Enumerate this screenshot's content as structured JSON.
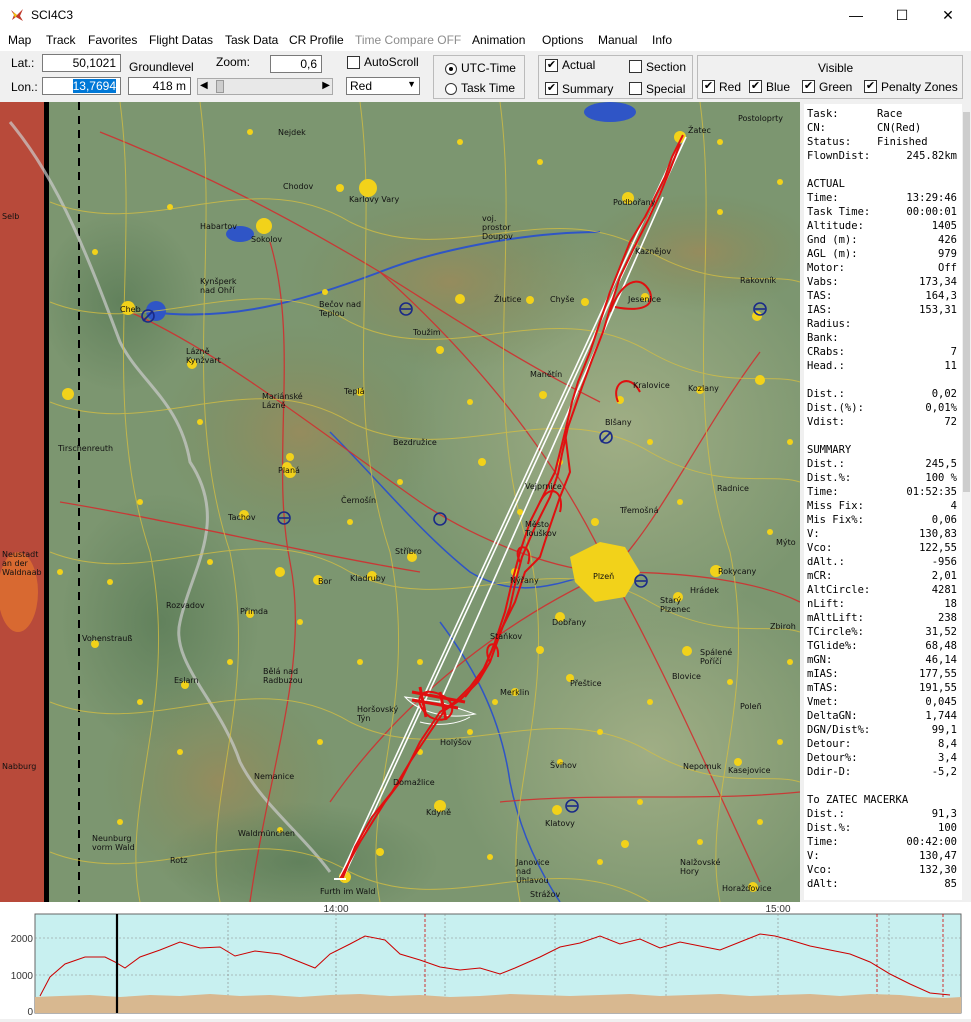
{
  "window": {
    "title": "SCI4C3",
    "minimize": "—",
    "maximize": "☐",
    "close": "✕"
  },
  "menu": [
    "Map",
    "Track",
    "Favorites",
    "Flight Datas",
    "Task Data",
    "CR Profile",
    "Time Compare OFF",
    "Animation",
    "Options",
    "Manual",
    "Info"
  ],
  "toolbar": {
    "lat_label": "Lat.:",
    "lat_value": "50,1021",
    "lon_label": "Lon.:",
    "lon_value": "13,7694",
    "groundlevel_label": "Groundlevel",
    "groundlevel_value": "418 m",
    "zoom_label": "Zoom:",
    "zoom_value": "0,6",
    "autoscroll_label": "AutoScroll",
    "autoscroll_checked": false,
    "pilot_select": "Red",
    "utc_label": "UTC-Time",
    "task_time_label": "Task Time",
    "time_mode": "UTC-Time",
    "actual_label": "Actual",
    "summary_label": "Summary",
    "section_label": "Section",
    "special_label": "Special",
    "visible_title": "Visible",
    "visible_items": [
      {
        "label": "Red",
        "checked": true
      },
      {
        "label": "Blue",
        "checked": true
      },
      {
        "label": "Green",
        "checked": true
      },
      {
        "label": "Penalty Zones",
        "checked": true
      }
    ]
  },
  "map": {
    "towns": [
      {
        "name": "Nejdek"
      },
      {
        "name": "Chodov"
      },
      {
        "name": "Karlovy Vary"
      },
      {
        "name": "Habartov"
      },
      {
        "name": "Sokolov"
      },
      {
        "name": "voj. prostor Doupov"
      },
      {
        "name": "Podbořany"
      },
      {
        "name": "Kynšperk nad Ohří"
      },
      {
        "name": "Cheb"
      },
      {
        "name": "Bečov nad Teplou"
      },
      {
        "name": "Toužim"
      },
      {
        "name": "Žlutice"
      },
      {
        "name": "Chyše"
      },
      {
        "name": "Lázně Kynžvart"
      },
      {
        "name": "Mariánské Lázně"
      },
      {
        "name": "Teplá"
      },
      {
        "name": "Manětín"
      },
      {
        "name": "Kralovice"
      },
      {
        "name": "Kozlany"
      },
      {
        "name": "Bezdružice"
      },
      {
        "name": "Tirschenreuth"
      },
      {
        "name": "Planá"
      },
      {
        "name": "Černošín"
      },
      {
        "name": "Tachov"
      },
      {
        "name": "Stříbro"
      },
      {
        "name": "Kladruby"
      },
      {
        "name": "Bor"
      },
      {
        "name": "Plzeň"
      },
      {
        "name": "Nýřany"
      },
      {
        "name": "Dobřany"
      },
      {
        "name": "Rozvadov"
      },
      {
        "name": "Přimda"
      },
      {
        "name": "Vohenstrauß"
      },
      {
        "name": "Staňkov"
      },
      {
        "name": "Přeštice"
      },
      {
        "name": "Horšovský Týn"
      },
      {
        "name": "Bělá nad Radbuzou"
      },
      {
        "name": "Merklin"
      },
      {
        "name": "Blovice"
      },
      {
        "name": "Nepomuk"
      },
      {
        "name": "Kdyně"
      },
      {
        "name": "Klatovy"
      },
      {
        "name": "Švihov"
      },
      {
        "name": "Nalžovské Hory"
      },
      {
        "name": "Horažďovice"
      },
      {
        "name": "Furth im Wald"
      },
      {
        "name": "Nabburg"
      },
      {
        "name": "Rokycany"
      },
      {
        "name": "Starý Plzenec"
      },
      {
        "name": "Spálené Poříčí"
      },
      {
        "name": "Kasejovice"
      },
      {
        "name": "Neunburg vorm Wald"
      },
      {
        "name": "Waldmünchen"
      },
      {
        "name": "Janovice nad Úhlavou"
      },
      {
        "name": "Strážov"
      },
      {
        "name": "Rakovník"
      },
      {
        "name": "Radnice"
      },
      {
        "name": "Třemošná"
      },
      {
        "name": "Město Touškov"
      },
      {
        "name": "Kaznějov"
      },
      {
        "name": "Jesenice"
      },
      {
        "name": "Blšany"
      },
      {
        "name": "Vejprnice"
      },
      {
        "name": "Mýto"
      },
      {
        "name": "Hrádek"
      },
      {
        "name": "Zbiroh"
      },
      {
        "name": "Poleñ"
      },
      {
        "name": "Domažlice"
      },
      {
        "name": "Selb"
      },
      {
        "name": "Neustadt an der Waldnaab"
      },
      {
        "name": "Žatec"
      },
      {
        "name": "Postoloprty"
      },
      {
        "name": "Holýšov"
      },
      {
        "name": "Nemanice"
      },
      {
        "name": "Rotz"
      },
      {
        "name": "Eslarn"
      }
    ]
  },
  "panel": [
    {
      "k": "Task:",
      "v": "Race",
      "left": true
    },
    {
      "k": "CN:",
      "v": "CN(Red)",
      "left": true
    },
    {
      "k": "Status:",
      "v": "Finished",
      "left": true
    },
    {
      "k": "FlownDist:",
      "v": "245.82km"
    },
    {
      "k": "",
      "v": ""
    },
    {
      "k": "ACTUAL",
      "v": ""
    },
    {
      "k": "Time:",
      "v": "13:29:46"
    },
    {
      "k": "Task Time:",
      "v": "00:00:01"
    },
    {
      "k": "Altitude:",
      "v": "1405"
    },
    {
      "k": "Gnd (m):",
      "v": "426"
    },
    {
      "k": "AGL (m):",
      "v": "979"
    },
    {
      "k": "Motor:",
      "v": "Off"
    },
    {
      "k": "Vabs:",
      "v": "173,34"
    },
    {
      "k": "TAS:",
      "v": "164,3"
    },
    {
      "k": "IAS:",
      "v": "153,31"
    },
    {
      "k": "Radius:",
      "v": ""
    },
    {
      "k": "Bank:",
      "v": ""
    },
    {
      "k": "CRabs:",
      "v": "7"
    },
    {
      "k": "Head.:",
      "v": "11"
    },
    {
      "k": "",
      "v": ""
    },
    {
      "k": "Dist.:",
      "v": "0,02"
    },
    {
      "k": "Dist.(%):",
      "v": "0,01%"
    },
    {
      "k": "Vdist:",
      "v": "72"
    },
    {
      "k": "",
      "v": ""
    },
    {
      "k": "SUMMARY",
      "v": ""
    },
    {
      "k": "Dist.:",
      "v": "245,5"
    },
    {
      "k": "Dist.%:",
      "v": "100 %"
    },
    {
      "k": "Time:",
      "v": "01:52:35"
    },
    {
      "k": "Miss Fix:",
      "v": "4"
    },
    {
      "k": "Mis Fix%:",
      "v": "0,06"
    },
    {
      "k": "V:",
      "v": "130,83"
    },
    {
      "k": "Vco:",
      "v": "122,55"
    },
    {
      "k": "dAlt.:",
      "v": "-956"
    },
    {
      "k": "mCR:",
      "v": "2,01"
    },
    {
      "k": "AltCircle:",
      "v": "4281"
    },
    {
      "k": "nLift:",
      "v": "18"
    },
    {
      "k": "mAltLift:",
      "v": "238"
    },
    {
      "k": "TCircle%:",
      "v": "31,52"
    },
    {
      "k": "TGlide%:",
      "v": "68,48"
    },
    {
      "k": "mGN:",
      "v": "46,14"
    },
    {
      "k": "mIAS:",
      "v": "177,55"
    },
    {
      "k": "mTAS:",
      "v": "191,55"
    },
    {
      "k": "Vmet:",
      "v": "0,045"
    },
    {
      "k": "DeltaGN:",
      "v": "1,744"
    },
    {
      "k": "DGN/Dist%:",
      "v": "99,1"
    },
    {
      "k": "Detour:",
      "v": "8,4"
    },
    {
      "k": "Detour%:",
      "v": "3,4"
    },
    {
      "k": "Ddir-D:",
      "v": "-5,2"
    },
    {
      "k": "",
      "v": ""
    },
    {
      "k": "To ZATEC MACERKA",
      "v": ""
    },
    {
      "k": "Dist.:",
      "v": "91,3"
    },
    {
      "k": "Dist.%:",
      "v": "100"
    },
    {
      "k": "Time:",
      "v": "00:42:00"
    },
    {
      "k": "V:",
      "v": "130,47"
    },
    {
      "k": "Vco:",
      "v": "132,30"
    },
    {
      "k": "dAlt:",
      "v": "85"
    }
  ],
  "profile": {
    "time_labels": [
      "14:00",
      "15:00"
    ],
    "y_labels": [
      "2000",
      "1000",
      "0"
    ],
    "colors": {
      "bg": "#c8f0f0",
      "altitude": "#d40000",
      "ground": "#d8b890",
      "marker": "#000000"
    }
  }
}
